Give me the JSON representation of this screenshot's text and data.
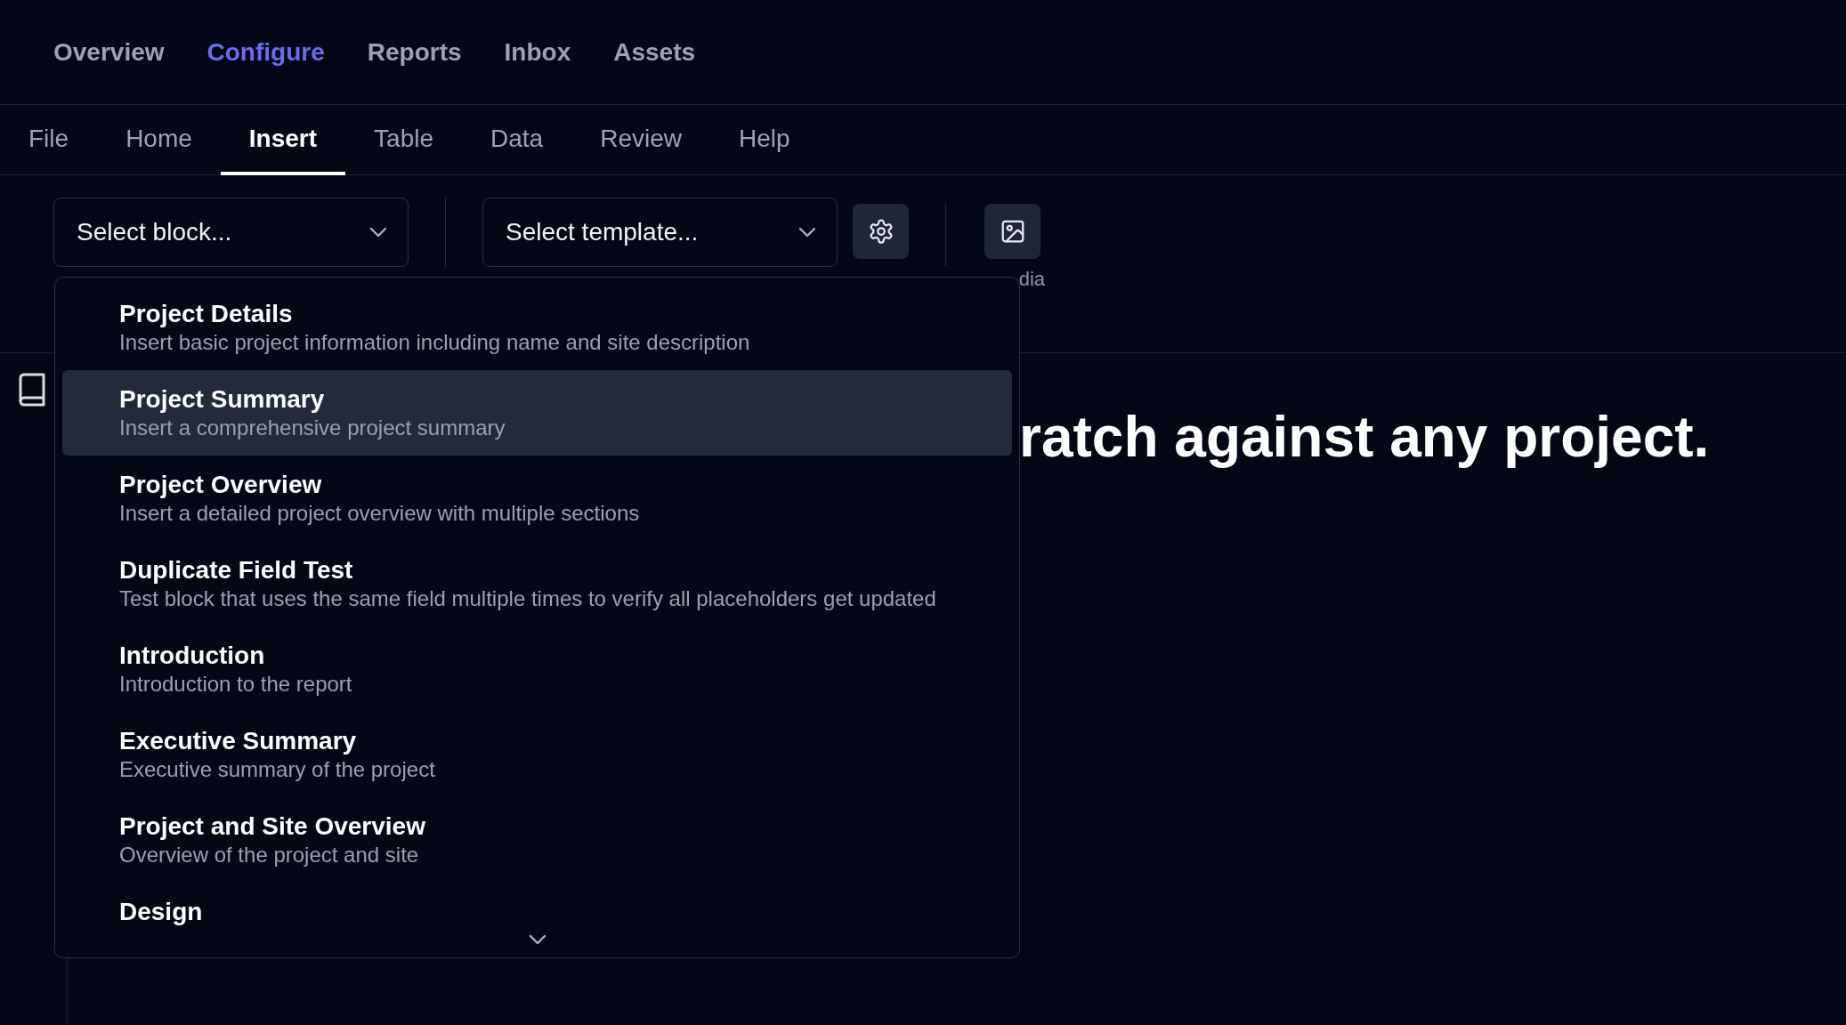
{
  "top_nav": [
    {
      "label": "Overview",
      "selected": false
    },
    {
      "label": "Configure",
      "selected": true
    },
    {
      "label": "Reports",
      "selected": false
    },
    {
      "label": "Inbox",
      "selected": false
    },
    {
      "label": "Assets",
      "selected": false
    }
  ],
  "ribbon_tabs": [
    {
      "label": "File",
      "selected": false
    },
    {
      "label": "Home",
      "selected": false
    },
    {
      "label": "Insert",
      "selected": true
    },
    {
      "label": "Table",
      "selected": false
    },
    {
      "label": "Data",
      "selected": false
    },
    {
      "label": "Review",
      "selected": false
    },
    {
      "label": "Help",
      "selected": false
    }
  ],
  "toolbar": {
    "block_select": {
      "placeholder": "Select block..."
    },
    "template_select": {
      "placeholder": "Select template..."
    },
    "media_label": "dia"
  },
  "block_menu": {
    "items": [
      {
        "title": "Project Details",
        "description": "Insert basic project information including name and site description",
        "selected": false
      },
      {
        "title": "Project Summary",
        "description": "Insert a comprehensive project summary",
        "selected": true
      },
      {
        "title": "Project Overview",
        "description": "Insert a detailed project overview with multiple sections",
        "selected": false
      },
      {
        "title": "Duplicate Field Test",
        "description": "Test block that uses the same field multiple times to verify all placeholders get updated",
        "selected": false
      },
      {
        "title": "Introduction",
        "description": "Introduction to the report",
        "selected": false
      },
      {
        "title": "Executive Summary",
        "description": "Executive summary of the project",
        "selected": false
      },
      {
        "title": "Project and Site Overview",
        "description": "Overview of the project and site",
        "selected": false
      },
      {
        "title": "Design",
        "selected": false
      }
    ]
  },
  "heading": "ratch against any project."
}
